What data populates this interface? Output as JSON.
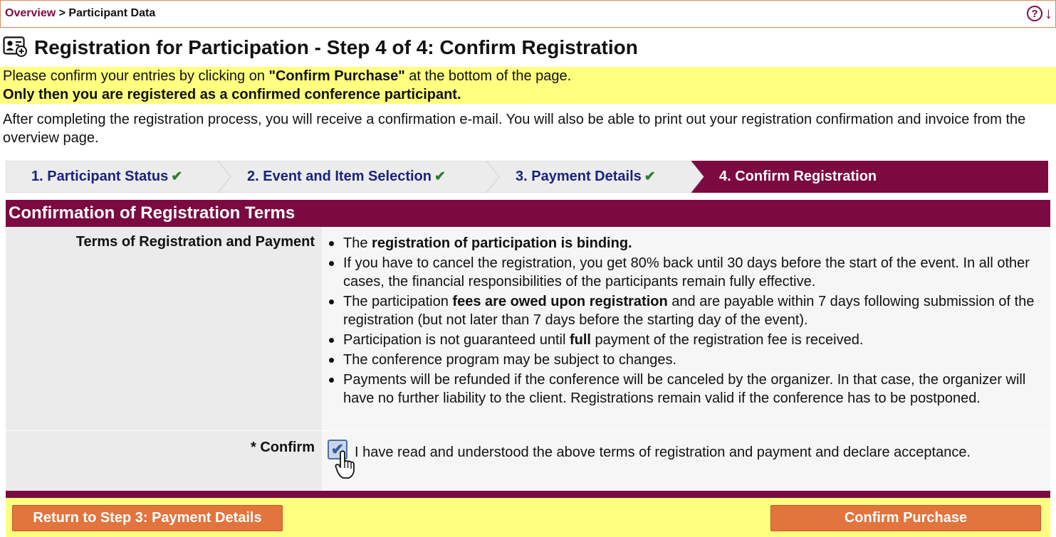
{
  "breadcrumb": {
    "link": "Overview",
    "separator": ">",
    "current": "Participant Data"
  },
  "top_icons": [
    "help-icon",
    "arrow-down-icon"
  ],
  "page_title": "Registration for Participation - Step 4 of 4: Confirm Registration",
  "notice": {
    "line1_prefix": "Please confirm your entries by clicking on ",
    "line1_bold": "\"Confirm Purchase\"",
    "line1_suffix": " at the bottom of the page.",
    "line2": "Only then you are registered as a confirmed conference participant."
  },
  "after_text": "After completing the registration process, you will receive a confirmation e-mail. You will also be able to print out your registration confirmation and invoice from the overview page.",
  "steps": [
    {
      "label": "1. Participant Status",
      "done": "✔"
    },
    {
      "label": "2. Event and Item Selection",
      "done": "✔"
    },
    {
      "label": "3. Payment Details",
      "done": "✔"
    },
    {
      "label": "4. Confirm Registration",
      "done": ""
    }
  ],
  "section_title": "Confirmation of Registration Terms",
  "terms": {
    "label": "Terms of Registration and Payment",
    "items": [
      {
        "pre": "The ",
        "bold": "registration of participation is binding.",
        "post": ""
      },
      {
        "pre": "If you have to cancel the registration, you get 80% back until 30 days before the start of the event. In all other cases, the financial responsibilities of the participants remain fully effective.",
        "bold": "",
        "post": ""
      },
      {
        "pre": "The participation ",
        "bold": "fees are owed upon registration",
        "post": " and are payable within 7 days following submission of the registration (but not later than 7 days before the starting day of the event)."
      },
      {
        "pre": "Participation is not guaranteed until ",
        "bold": "full",
        "post": " payment of the registration fee is received."
      },
      {
        "pre": "The conference program may be subject to changes.",
        "bold": "",
        "post": ""
      },
      {
        "pre": "Payments will be refunded if the conference will be canceled by the organizer. In that case, the organizer will have no further liability to the client. Registrations remain valid if the conference has to be postponed.",
        "bold": "",
        "post": ""
      }
    ]
  },
  "confirm": {
    "label": "* Confirm",
    "checked": true,
    "text": "I have read and understood the above terms of registration and payment and declare acceptance."
  },
  "buttons": {
    "back": "Return to Step 3: Payment Details",
    "confirm": "Confirm Purchase"
  },
  "colors": {
    "brand": "#7b0a40",
    "highlight": "#ffff80",
    "button": "#e2743e",
    "step_text": "#1a237e",
    "check_green": "#2e7d32"
  }
}
